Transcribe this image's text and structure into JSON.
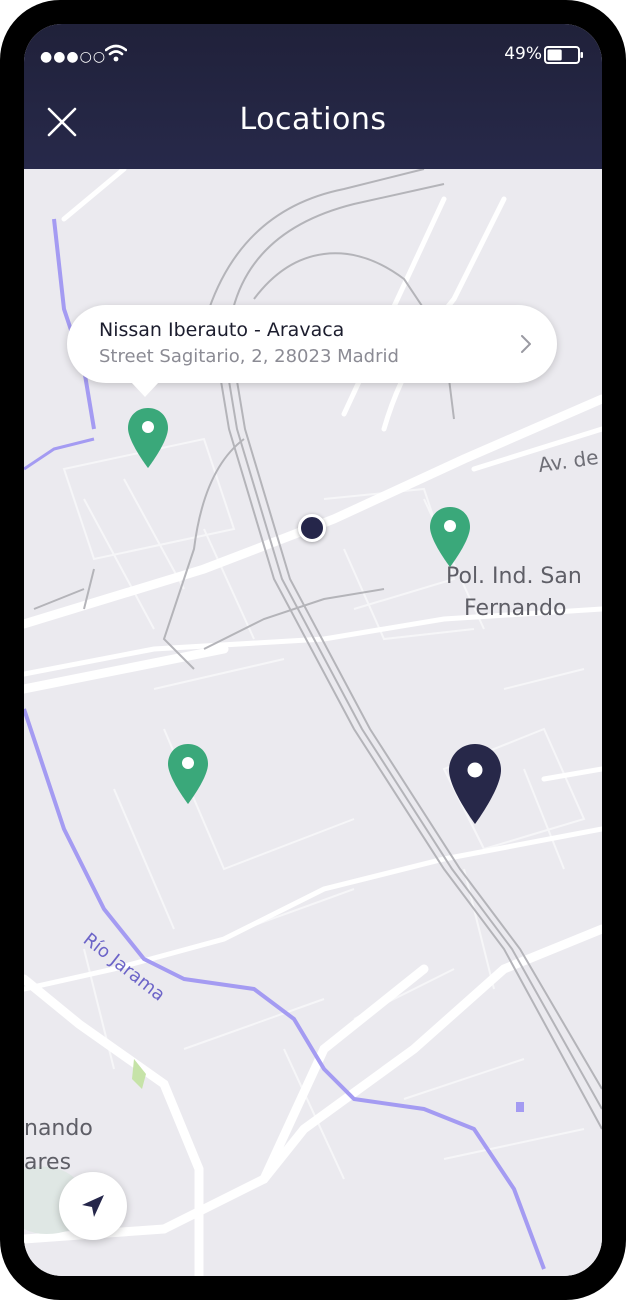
{
  "status_bar": {
    "signal": "●●●○○",
    "battery_percent": "49%",
    "battery_level": 0.49
  },
  "header": {
    "title": "Locations",
    "close_icon": "close-icon"
  },
  "callout": {
    "name": "Nissan Iberauto - Aravaca",
    "address": "Street Sagitario, 2, 28023 Madrid",
    "chevron_icon": "chevron-right-icon"
  },
  "map": {
    "labels": {
      "avenue": "Av. de",
      "poligono_line1": "Pol. Ind. San",
      "poligono_line2": "Fernando",
      "river": "Río Jarama",
      "town_line1": "nando",
      "town_line2": "ares"
    },
    "colors": {
      "dealer_pin": "#3aa87a",
      "selected_pin": "#272849",
      "background": "#ebeaef",
      "road": "#ffffff",
      "rail": "#b4b4b9",
      "river": "#a49bf2"
    }
  },
  "locate_button": {
    "icon": "navigation-arrow-icon"
  }
}
